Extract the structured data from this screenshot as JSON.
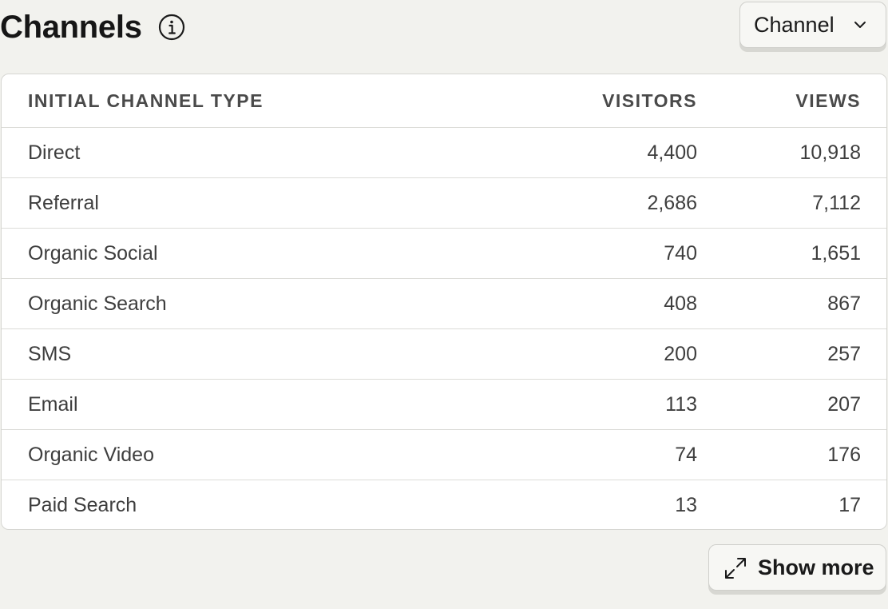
{
  "header": {
    "title": "Channels",
    "info_icon": "info-icon"
  },
  "dropdown": {
    "label": "Channel",
    "icon": "chevron-down-icon"
  },
  "table": {
    "columns": [
      "INITIAL CHANNEL TYPE",
      "VISITORS",
      "VIEWS"
    ],
    "rows": [
      {
        "name": "Direct",
        "visitors": "4,400",
        "views": "10,918"
      },
      {
        "name": "Referral",
        "visitors": "2,686",
        "views": "7,112"
      },
      {
        "name": "Organic Social",
        "visitors": "740",
        "views": "1,651"
      },
      {
        "name": "Organic Search",
        "visitors": "408",
        "views": "867"
      },
      {
        "name": "SMS",
        "visitors": "200",
        "views": "257"
      },
      {
        "name": "Email",
        "visitors": "113",
        "views": "207"
      },
      {
        "name": "Organic Video",
        "visitors": "74",
        "views": "176"
      },
      {
        "name": "Paid Search",
        "visitors": "13",
        "views": "17"
      }
    ]
  },
  "footer": {
    "show_more_label": "Show more",
    "show_more_icon": "expand-icon"
  },
  "colors": {
    "background": "#f2f2ee",
    "card": "#ffffff",
    "border": "#d6d6d2",
    "text_primary": "#1a1a1a",
    "text_secondary": "#3e3e3e"
  }
}
